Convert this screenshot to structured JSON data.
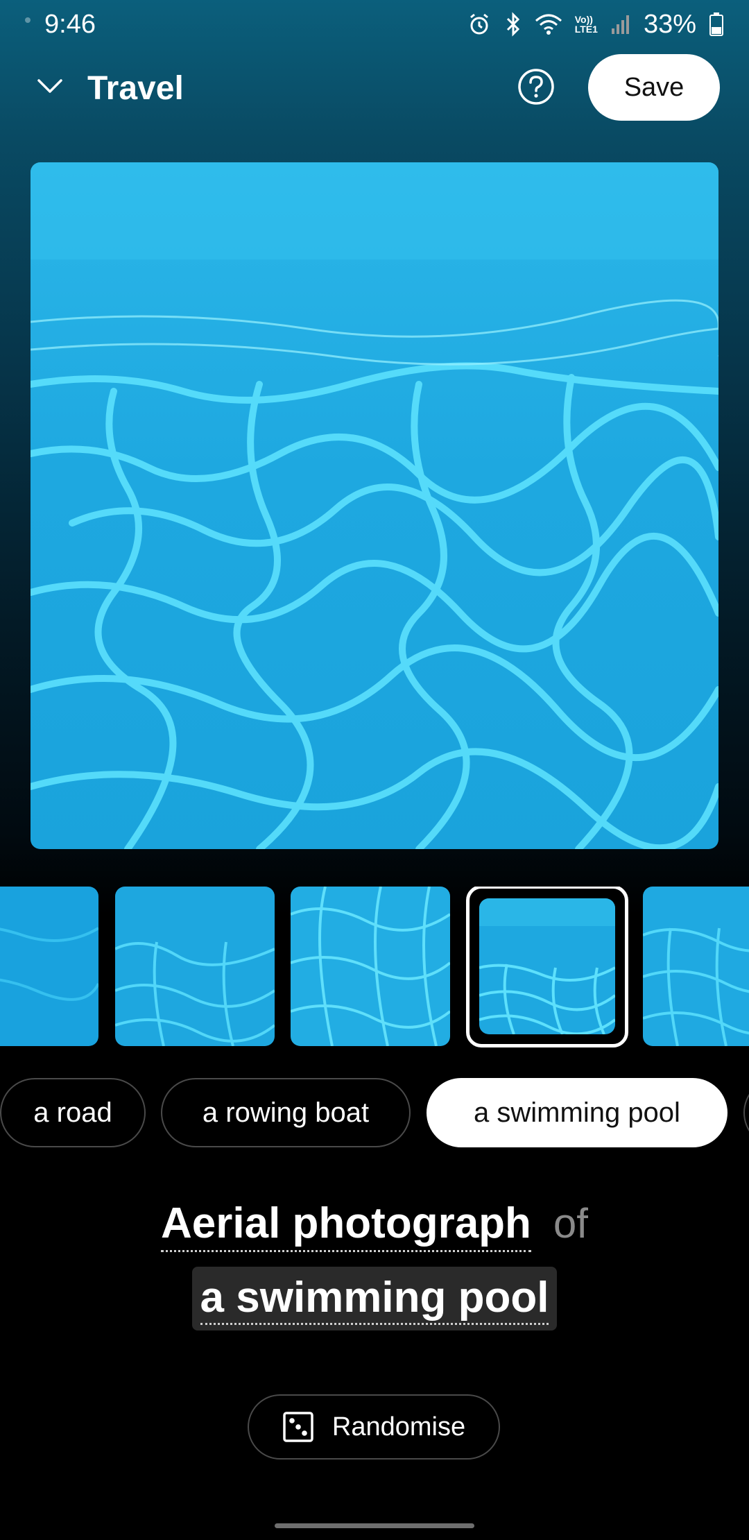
{
  "status_bar": {
    "time": "9:46",
    "battery_percent": "33%",
    "icons": [
      "alarm-icon",
      "bluetooth-icon",
      "wifi-icon",
      "volte-lte-icon",
      "signal-icon",
      "battery-icon"
    ],
    "network_label_top": "Vo))",
    "network_label_bottom": "LTE1"
  },
  "header": {
    "title": "Travel",
    "save_label": "Save",
    "help_icon": "question-circle-icon",
    "collapse_icon": "chevron-down-icon"
  },
  "thumbnails": {
    "count": 5,
    "selected_index": 3
  },
  "chips": [
    {
      "label": "a road",
      "selected": false
    },
    {
      "label": "a rowing boat",
      "selected": false
    },
    {
      "label": "a swimming pool",
      "selected": true
    }
  ],
  "prompt": {
    "style": "Aerial photograph",
    "connector": "of",
    "subject": "a swimming pool"
  },
  "randomise": {
    "label": "Randomise",
    "icon": "dice-icon"
  },
  "colors": {
    "water_light": "#3fd3f5",
    "water_base": "#1aa7dd",
    "water_deep": "#0e8ec6",
    "selected_chip_bg": "#ffffff"
  }
}
